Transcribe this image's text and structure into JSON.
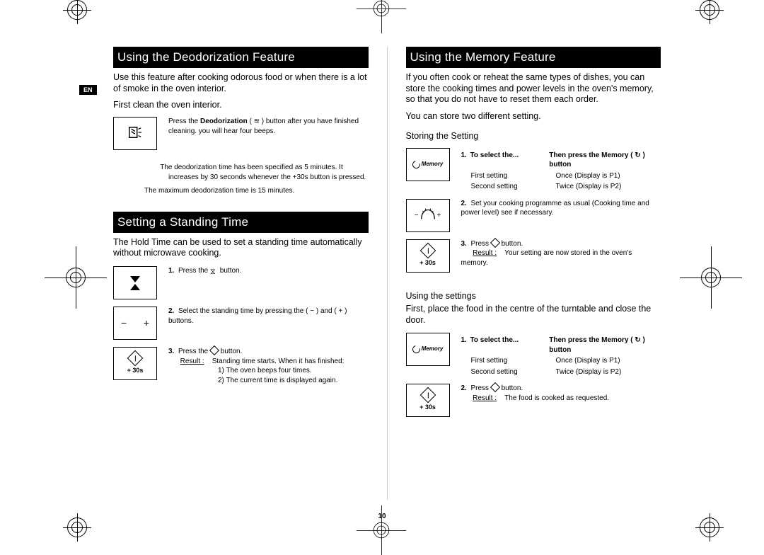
{
  "badge": "EN",
  "page_number": "10",
  "left": {
    "section1": {
      "title": "Using the Deodorization Feature",
      "intro": "Use this feature after cooking odorous food or when there is a lot of smoke in the oven interior.",
      "sub": "First clean the oven interior.",
      "step_text_a": "Press the ",
      "step_bold": "Deodorization",
      "step_text_b": " ( ≋ ) button after you have finished cleaning. you will hear four beeps.",
      "note1": "The deodorization time has been specified as 5 minutes. It increases by 30 seconds whenever the +30s button is pressed.",
      "note2": "The maximum deodorization time is 15 minutes."
    },
    "section2": {
      "title": "Setting a Standing Time",
      "intro": "The Hold Time can be used to set a standing time automatically without microwave cooking.",
      "s1_a": "Press the ",
      "s1_b": " button.",
      "s2": "Select the standing time by pressing the ( − ) and ( + ) buttons.",
      "s3_a": "Press the ",
      "s3_b": " button.",
      "res_label": "Result :",
      "res_items": [
        "1)   The oven beeps four times.",
        "2)   The current time is displayed again."
      ],
      "res_intro": "Standing time starts. When it has finished:"
    }
  },
  "right": {
    "section": {
      "title": "Using the Memory Feature",
      "intro": "If you often cook or reheat the same types of dishes, you can store the cooking times and power levels in the oven's memory, so that you do not have to reset them each order.",
      "sub": "You can store two different setting.",
      "storing_title": "Storing the Setting",
      "tbl_h1": "To select the...",
      "tbl_h2": "Then press the Memory ( ↻ ) button",
      "rows": [
        {
          "c1": "First setting",
          "c2": "Once (Display is P1)"
        },
        {
          "c1": "Second setting",
          "c2": "Twice (Display is P2)"
        }
      ],
      "s2": "Set your cooking programme as usual (Cooking time and power level) see if necessary.",
      "s3_a": "Press ",
      "s3_b": " button.",
      "res_label": "Result :",
      "res_text": "Your setting are now stored in the oven's memory.",
      "using_title": "Using the settings",
      "using_intro": "First, place the food in the centre of the turntable and close the door.",
      "u_s2_a": "Press ",
      "u_s2_b": " button.",
      "u_res_text": "The food is cooked as requested."
    }
  },
  "icons": {
    "plus30": "+ 30s"
  }
}
